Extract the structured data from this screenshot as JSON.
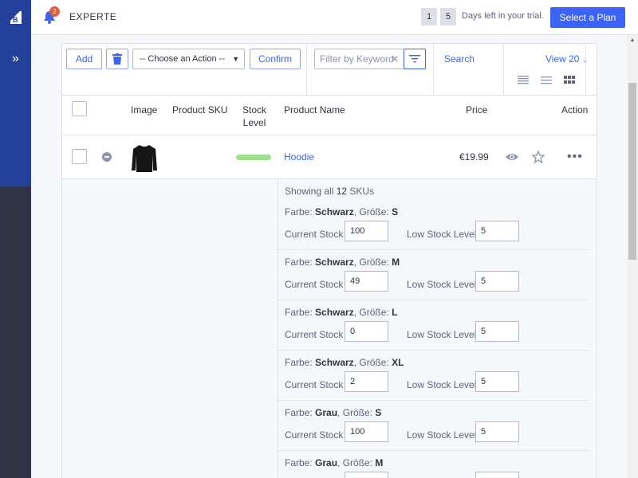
{
  "header": {
    "notification_count": "2",
    "store_name": "EXPERTE",
    "days_left_digits": [
      "1",
      "5"
    ],
    "trial_text": "Days left in your trial.",
    "select_plan": "Select a Plan"
  },
  "toolbar": {
    "add": "Add",
    "action_select": "-- Choose an Action --",
    "confirm": "Confirm",
    "filter_placeholder": "Filter by Keyword",
    "search": "Search",
    "view": "View 20"
  },
  "table": {
    "headers": {
      "image": "Image",
      "sku": "Product SKU",
      "stock_level": "Stock Level",
      "product_name": "Product Name",
      "price": "Price",
      "action": "Action"
    },
    "row": {
      "product_name": "Hoodie",
      "price": "€19.99",
      "stock_level_fraction": 1.0
    }
  },
  "details": {
    "showing_prefix": "Showing all",
    "showing_count": "12",
    "showing_suffix": "SKUs",
    "current_stock_label": "Current Stock",
    "low_stock_label": "Low Stock Level",
    "farbe_label": "Farbe:",
    "groesse_label": "Größe:",
    "skus": [
      {
        "farbe": "Schwarz",
        "groesse": "S",
        "current_stock": "100",
        "low_stock": "5"
      },
      {
        "farbe": "Schwarz",
        "groesse": "M",
        "current_stock": "49",
        "low_stock": "5"
      },
      {
        "farbe": "Schwarz",
        "groesse": "L",
        "current_stock": "0",
        "low_stock": "5"
      },
      {
        "farbe": "Schwarz",
        "groesse": "XL",
        "current_stock": "2",
        "low_stock": "5"
      },
      {
        "farbe": "Grau",
        "groesse": "S",
        "current_stock": "100",
        "low_stock": "5"
      },
      {
        "farbe": "Grau",
        "groesse": "M",
        "current_stock": "",
        "low_stock": ""
      }
    ]
  },
  "colors": {
    "brand_blue": "#3c64f4",
    "nav_blue": "#23409b",
    "nav_dark": "#303346",
    "stock_green": "#9fe08c"
  }
}
